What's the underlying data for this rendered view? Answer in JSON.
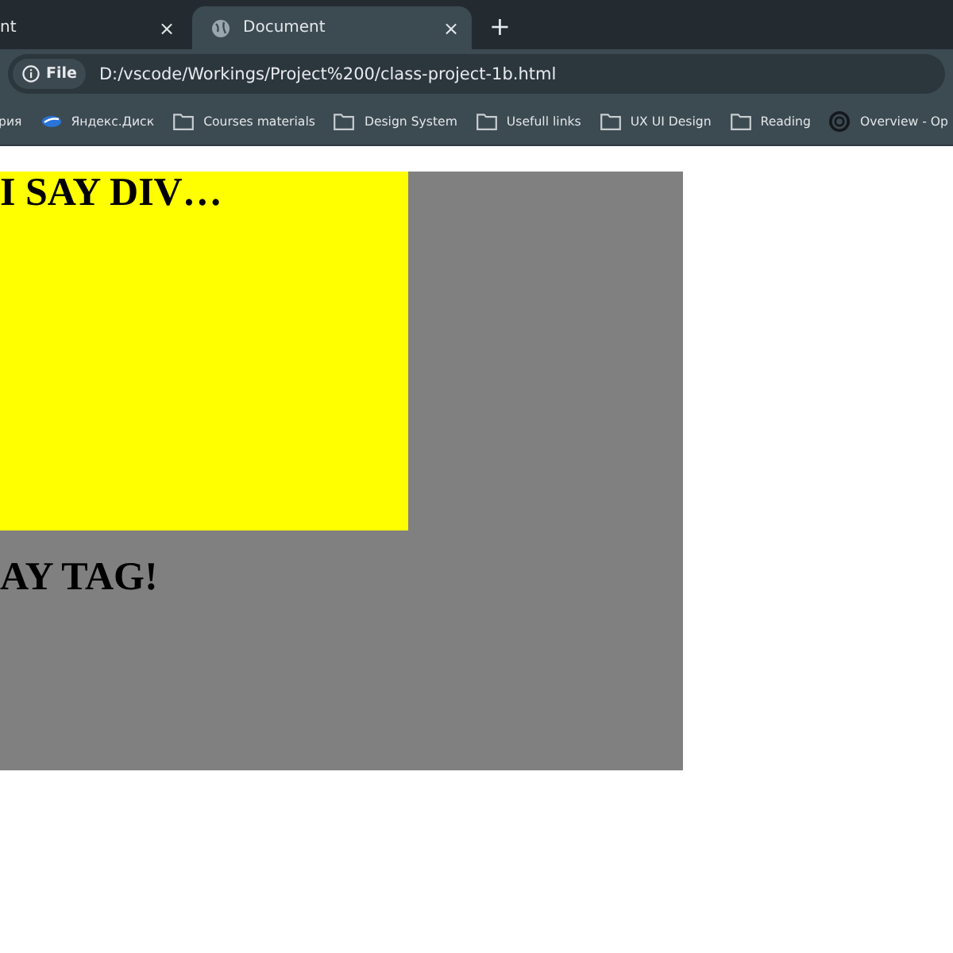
{
  "tabs": [
    {
      "label": "nt",
      "close": "×",
      "selected": false
    },
    {
      "label": "Document",
      "close": "×",
      "selected": true
    }
  ],
  "new_tab": "+",
  "address_bar": {
    "scheme": "File",
    "url": "D:/vscode/Workings/Project%200/class-project-1b.html"
  },
  "bookmarks": [
    {
      "label": "рия",
      "kind": "text"
    },
    {
      "label": "Яндекс.Диск",
      "kind": "disk"
    },
    {
      "label": "Courses materials",
      "kind": "folder"
    },
    {
      "label": "Design System",
      "kind": "folder"
    },
    {
      "label": "Usefull links",
      "kind": "folder"
    },
    {
      "label": "UX UI Design",
      "kind": "folder"
    },
    {
      "label": "Reading",
      "kind": "folder"
    },
    {
      "label": "Overview - Op",
      "kind": "site"
    }
  ],
  "page": {
    "div_heading": "I SAY DIV…",
    "tag_heading": "AY TAG!"
  }
}
